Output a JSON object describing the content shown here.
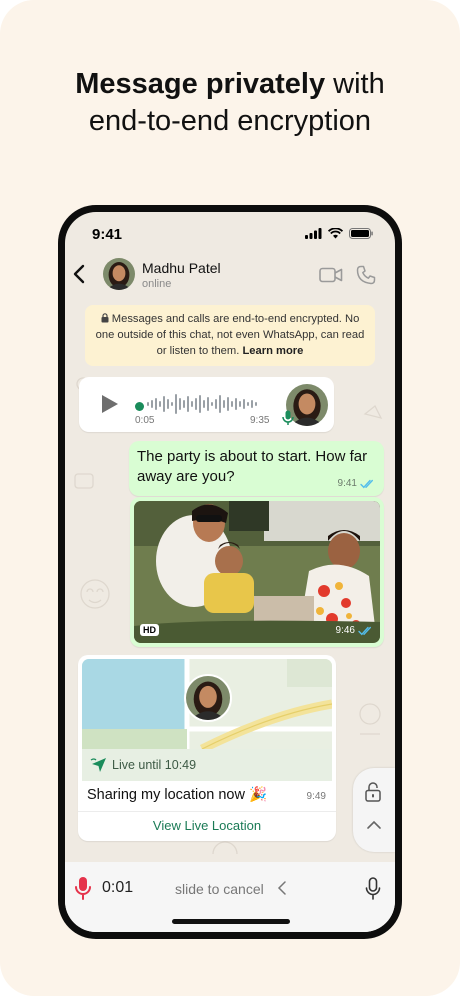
{
  "headline": {
    "bold": "Message privately",
    "rest": " with",
    "line2": "end-to-end encryption"
  },
  "status_bar": {
    "time": "9:41",
    "icons": [
      "signal-icon",
      "wifi-icon",
      "battery-icon"
    ]
  },
  "chat_header": {
    "contact_name": "Madhu Patel",
    "status": "online",
    "icons": [
      "back-icon",
      "video-call-icon",
      "voice-call-icon"
    ]
  },
  "encryption_notice": {
    "text": "Messages and calls are end-to-end encrypted. No one outside of this chat, not even WhatsApp, can read or listen to them.",
    "link": "Learn more"
  },
  "voice_message": {
    "elapsed": "0:05",
    "time": "9:35"
  },
  "message_text": {
    "text": "The party is about to start. How far away are you?",
    "time": "9:41"
  },
  "photo_message": {
    "badge": "HD",
    "time": "9:46"
  },
  "location_message": {
    "live_label": "Live until 10:49",
    "caption": "Sharing my location now 🎉",
    "time": "9:49",
    "action": "View Live Location"
  },
  "recording_bar": {
    "elapsed": "0:01",
    "hint": "slide to cancel"
  },
  "colors": {
    "background": "#fcf4ea",
    "outgoing_bubble": "#d9fdd3",
    "accent_green": "#1a8c5b",
    "record_red": "#e5334b",
    "read_tick": "#53bdeb"
  }
}
